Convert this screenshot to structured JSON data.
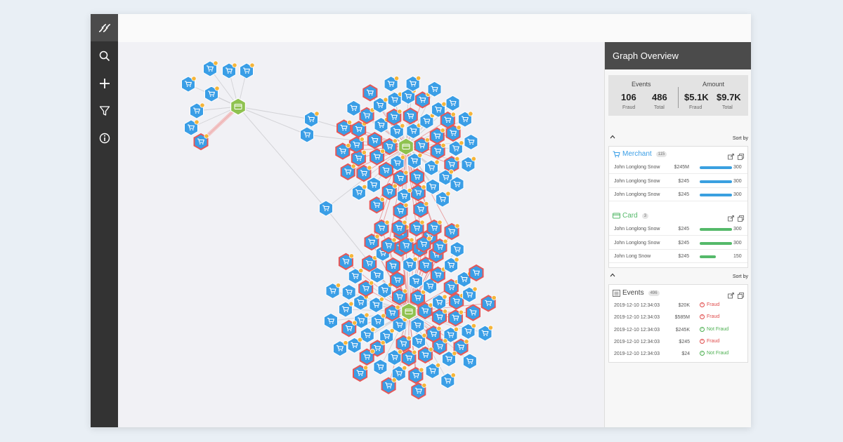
{
  "colors": {
    "sidebar": "#333333",
    "panel_header": "#4b4b4b",
    "merchant_node": "#3a9ee6",
    "fraud_outline": "#e65757",
    "card_node": "#8fc250",
    "badge_dot": "#f5b53a",
    "merchant_bar": "#3aa0e0",
    "card_bar": "#55b96a",
    "fraud_text": "#e04d4d",
    "notfraud_text": "#4caf50"
  },
  "sidebar": {
    "logo_icon": "dna-logo-icon",
    "items": [
      {
        "icon": "search-icon"
      },
      {
        "icon": "plus-icon"
      },
      {
        "icon": "filter-icon"
      },
      {
        "icon": "info-icon"
      }
    ]
  },
  "graph": {
    "node_icon": "shopping-cart-icon",
    "hub_icon": "credit-card-icon"
  },
  "panel": {
    "title": "Graph Overview",
    "stats": {
      "events_label": "Events",
      "amount_label": "Amount",
      "events_fraud": "106",
      "events_total": "486",
      "amount_fraud": "$5.1K",
      "amount_total": "$9.7K",
      "fraud_sub": "Fraud",
      "total_sub": "Total"
    },
    "sort_label": "Sort by",
    "merchant": {
      "title": "Merchant",
      "count": "115",
      "rows": [
        {
          "name": "John Longlong Snow",
          "amount": "$245M",
          "value": "300",
          "fill": 1.0
        },
        {
          "name": "John Longlong Snow",
          "amount": "$245",
          "value": "300",
          "fill": 1.0
        },
        {
          "name": "John Longlong Snow",
          "amount": "$245",
          "value": "300",
          "fill": 1.0
        }
      ]
    },
    "card": {
      "title": "Card",
      "count": "3",
      "rows": [
        {
          "name": "John Longlong Snow",
          "amount": "$245",
          "value": "300",
          "fill": 1.0
        },
        {
          "name": "John Longlong Snow",
          "amount": "$245",
          "value": "300",
          "fill": 1.0
        },
        {
          "name": "John Long Snow",
          "amount": "$245",
          "value": "150",
          "fill": 0.5
        }
      ]
    },
    "events": {
      "title": "Events",
      "count": "496",
      "rows": [
        {
          "date": "2019-12-10  12:34:03",
          "amount": "$20K",
          "status": "Fraud",
          "fraud": true
        },
        {
          "date": "2019-12-10  12:34:03",
          "amount": "$585M",
          "status": "Fraud",
          "fraud": true
        },
        {
          "date": "2019-12-10  12:34:03",
          "amount": "$245K",
          "status": "Not Fraud",
          "fraud": false
        },
        {
          "date": "2019-12-10  12:34:03",
          "amount": "$245",
          "status": "Fraud",
          "fraud": true
        },
        {
          "date": "2019-12-10  12:34:03",
          "amount": "$24",
          "status": "Not Fraud",
          "fraud": false
        }
      ]
    }
  }
}
